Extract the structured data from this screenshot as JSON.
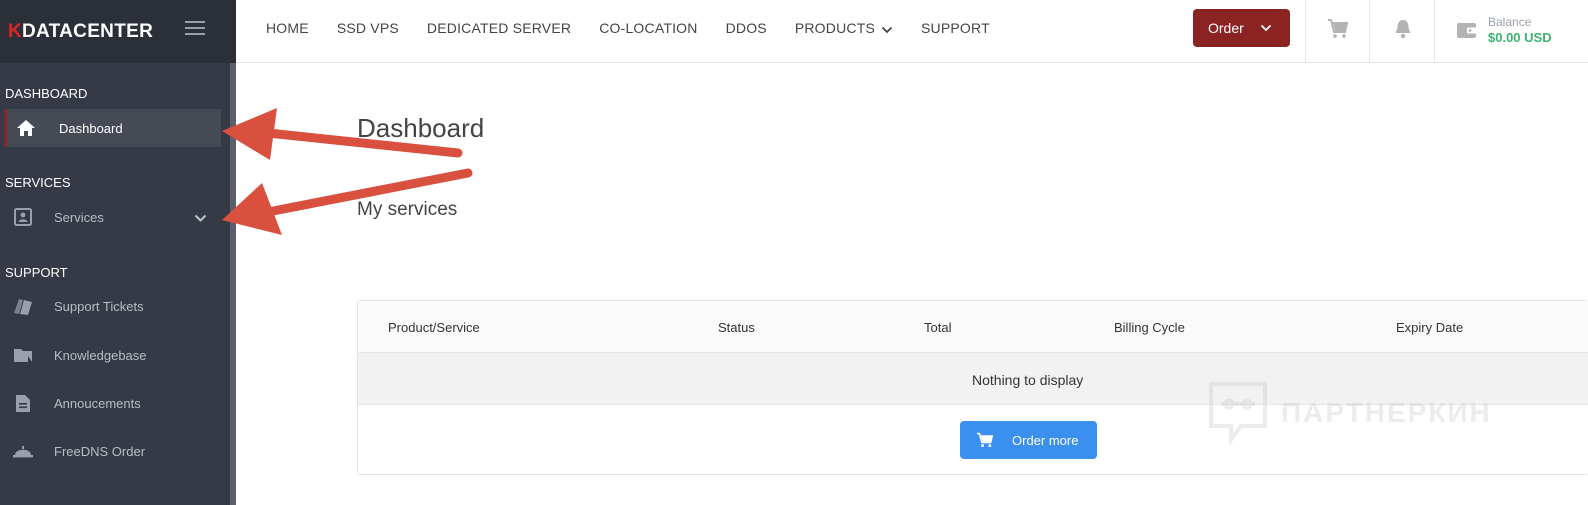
{
  "sidebar": {
    "logo_k": "K",
    "logo_rest": "DATACENTER",
    "sections": {
      "dashboard": "DASHBOARD",
      "services": "SERVICES",
      "support": "SUPPORT"
    },
    "items": [
      {
        "label": "Dashboard",
        "icon": "home-icon",
        "active": true
      },
      {
        "label": "Services",
        "icon": "contact-card-icon",
        "active": false
      },
      {
        "label": "Support Tickets",
        "icon": "ticket-icon",
        "active": false
      },
      {
        "label": "Knowledgebase",
        "icon": "folder-icon",
        "active": false
      },
      {
        "label": "Annoucements",
        "icon": "document-icon",
        "active": false
      },
      {
        "label": "FreeDNS Order",
        "icon": "dome-icon",
        "active": false
      }
    ]
  },
  "topnav": {
    "items": [
      "HOME",
      "SSD VPS",
      "DEDICATED SERVER",
      "CO-LOCATION",
      "DDOS",
      "PRODUCTS",
      "SUPPORT"
    ],
    "order_label": "Order",
    "balance_label": "Balance",
    "balance_value": "$0.00 USD"
  },
  "main": {
    "title": "Dashboard",
    "services_title": "My services",
    "table": {
      "columns": [
        "Product/Service",
        "Status",
        "Total",
        "Billing Cycle",
        "Expiry Date"
      ],
      "empty": "Nothing to display"
    },
    "order_more": "Order more"
  },
  "watermark": "ПАРТНЕРКИН",
  "colors": {
    "sidebar_bg": "#353a46",
    "accent_red": "#8b2323",
    "order_more_blue": "#3b8fef",
    "balance_green": "#3cb371",
    "arrow_red": "#d9503f"
  }
}
